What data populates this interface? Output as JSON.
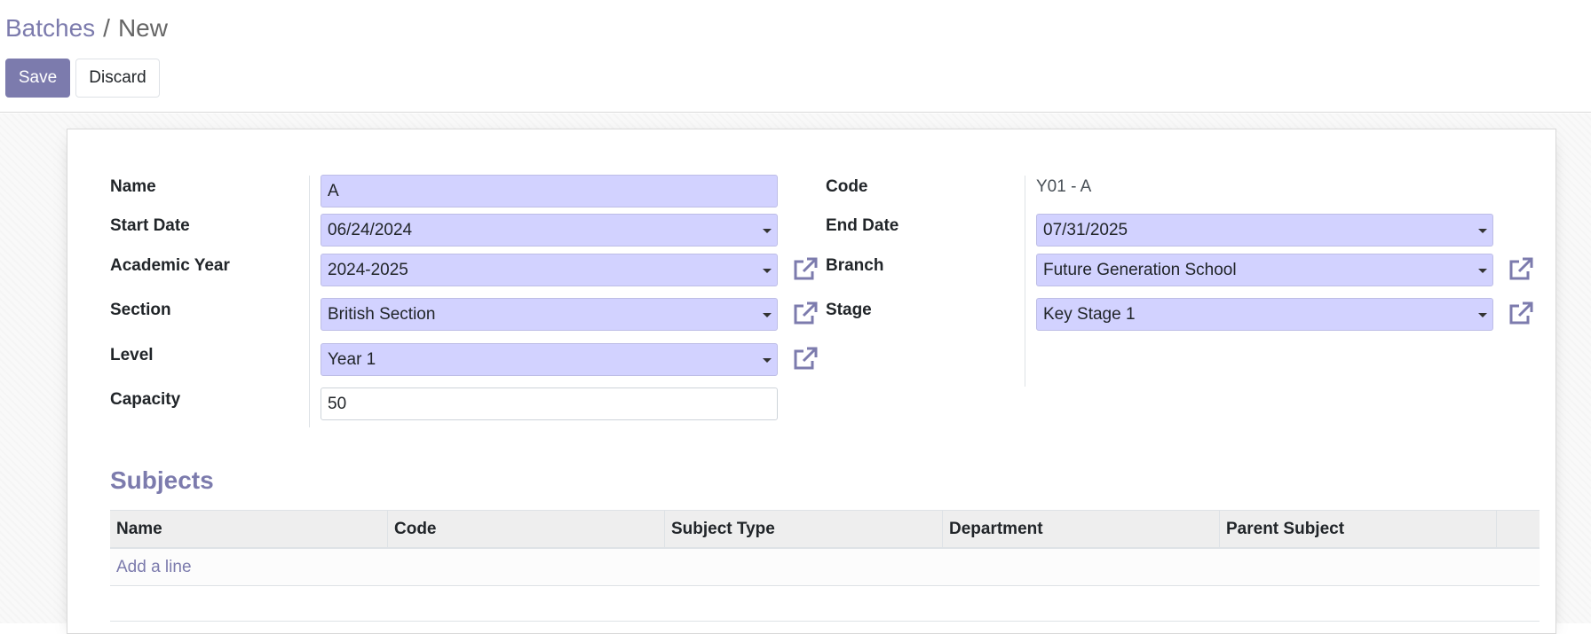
{
  "breadcrumb": {
    "parent": "Batches",
    "separator": "/",
    "current": "New"
  },
  "toolbar": {
    "save_label": "Save",
    "discard_label": "Discard"
  },
  "form": {
    "name": {
      "label": "Name",
      "value": "A"
    },
    "start_date": {
      "label": "Start Date",
      "value": "06/24/2024"
    },
    "academic_year": {
      "label": "Academic Year",
      "value": "2024-2025"
    },
    "section": {
      "label": "Section",
      "value": "British Section"
    },
    "level": {
      "label": "Level",
      "value": "Year 1"
    },
    "capacity": {
      "label": "Capacity",
      "value": "50"
    },
    "code": {
      "label": "Code",
      "value": "Y01 - A"
    },
    "end_date": {
      "label": "End Date",
      "value": "07/31/2025"
    },
    "branch": {
      "label": "Branch",
      "value": "Future Generation School"
    },
    "stage": {
      "label": "Stage",
      "value": "Key Stage 1"
    }
  },
  "subjects": {
    "title": "Subjects",
    "columns": [
      "Name",
      "Code",
      "Subject Type",
      "Department",
      "Parent Subject"
    ],
    "add_line_label": "Add a line"
  },
  "icons": {
    "external_link": "external-link-icon",
    "dropdown": "chevron-down-icon"
  },
  "colors": {
    "accent": "#7c7bad",
    "required_field_bg": "#d2d2ff"
  }
}
